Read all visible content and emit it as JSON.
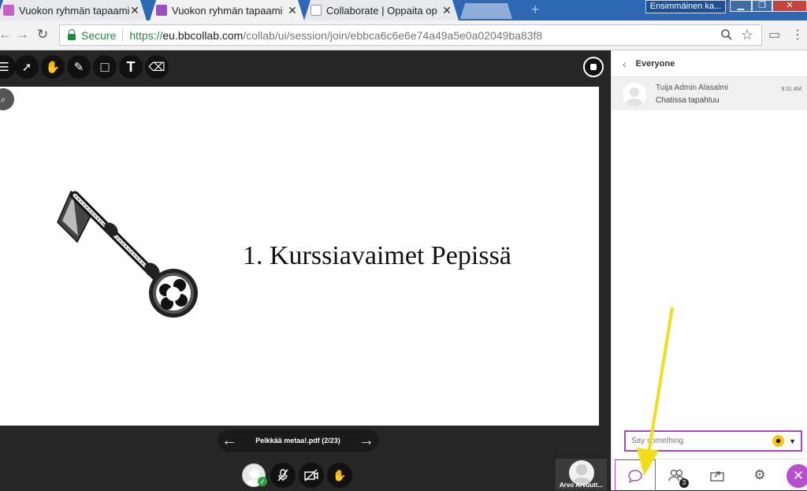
{
  "browser": {
    "tabs": [
      {
        "title": "Vuokon ryhmän tapaami",
        "favicon_color": "#c85ec7",
        "close": "✕"
      },
      {
        "title": "Vuokon ryhmän tapaami",
        "favicon_color": "#9a4fc4",
        "close": "✕"
      },
      {
        "title": "Collaborate | Oppaita op",
        "favicon_color": "#bbbbbb",
        "close": "✕"
      }
    ],
    "new_tab": "+",
    "profile": "Ensimmäinen ka...",
    "window_controls": {
      "minimize": "▁",
      "maximize": "❐",
      "close": "✕"
    },
    "nav": {
      "back": "←",
      "forward": "→",
      "reload": "↻"
    },
    "security_label": "Secure",
    "url_scheme": "https://",
    "url_host": "eu.bbcollab.com",
    "url_path": "/collab/ui/session/join/ebbca6c6e6e74a49a5e0a02049ba83f8"
  },
  "whiteboard_tools": [
    {
      "name": "menu-icon",
      "glyph": "☰"
    },
    {
      "name": "select-icon",
      "glyph": "➚"
    },
    {
      "name": "pan-icon",
      "glyph": "✋"
    },
    {
      "name": "pencil-icon",
      "glyph": "✎"
    },
    {
      "name": "shape-icon",
      "glyph": "□"
    },
    {
      "name": "text-icon",
      "glyph": "T"
    },
    {
      "name": "eraser-icon",
      "glyph": "⌫"
    }
  ],
  "slide": {
    "title": "1. Kurssiavaimet Pepissä"
  },
  "pager": {
    "prev": "←",
    "next": "→",
    "file_label": "Pelkkää metaa!.pdf  (2/23)"
  },
  "av_controls": {
    "check": "✓",
    "mic": "🎙",
    "camera": "⊡",
    "hand": "✋"
  },
  "participant": {
    "name": "Arvo Arvuutt..."
  },
  "chat": {
    "back": "‹",
    "header": "Everyone",
    "messages": [
      {
        "author": "Tuija Admin Alasalmi",
        "text": "Chatissa tapahtuu",
        "time": "9:31 AM"
      }
    ],
    "placeholder": "Say something",
    "emoji": "☻",
    "caret": "▼"
  },
  "panel_nav": {
    "chat": "◯",
    "attendees": "⚇",
    "attendees_count": "3",
    "share": "⇪",
    "settings": "⚙",
    "close": "✕"
  },
  "colors": {
    "accent": "#a64bbd",
    "annotation_arrow": "#f2dd1a",
    "secure_green": "#1e8e3e"
  }
}
